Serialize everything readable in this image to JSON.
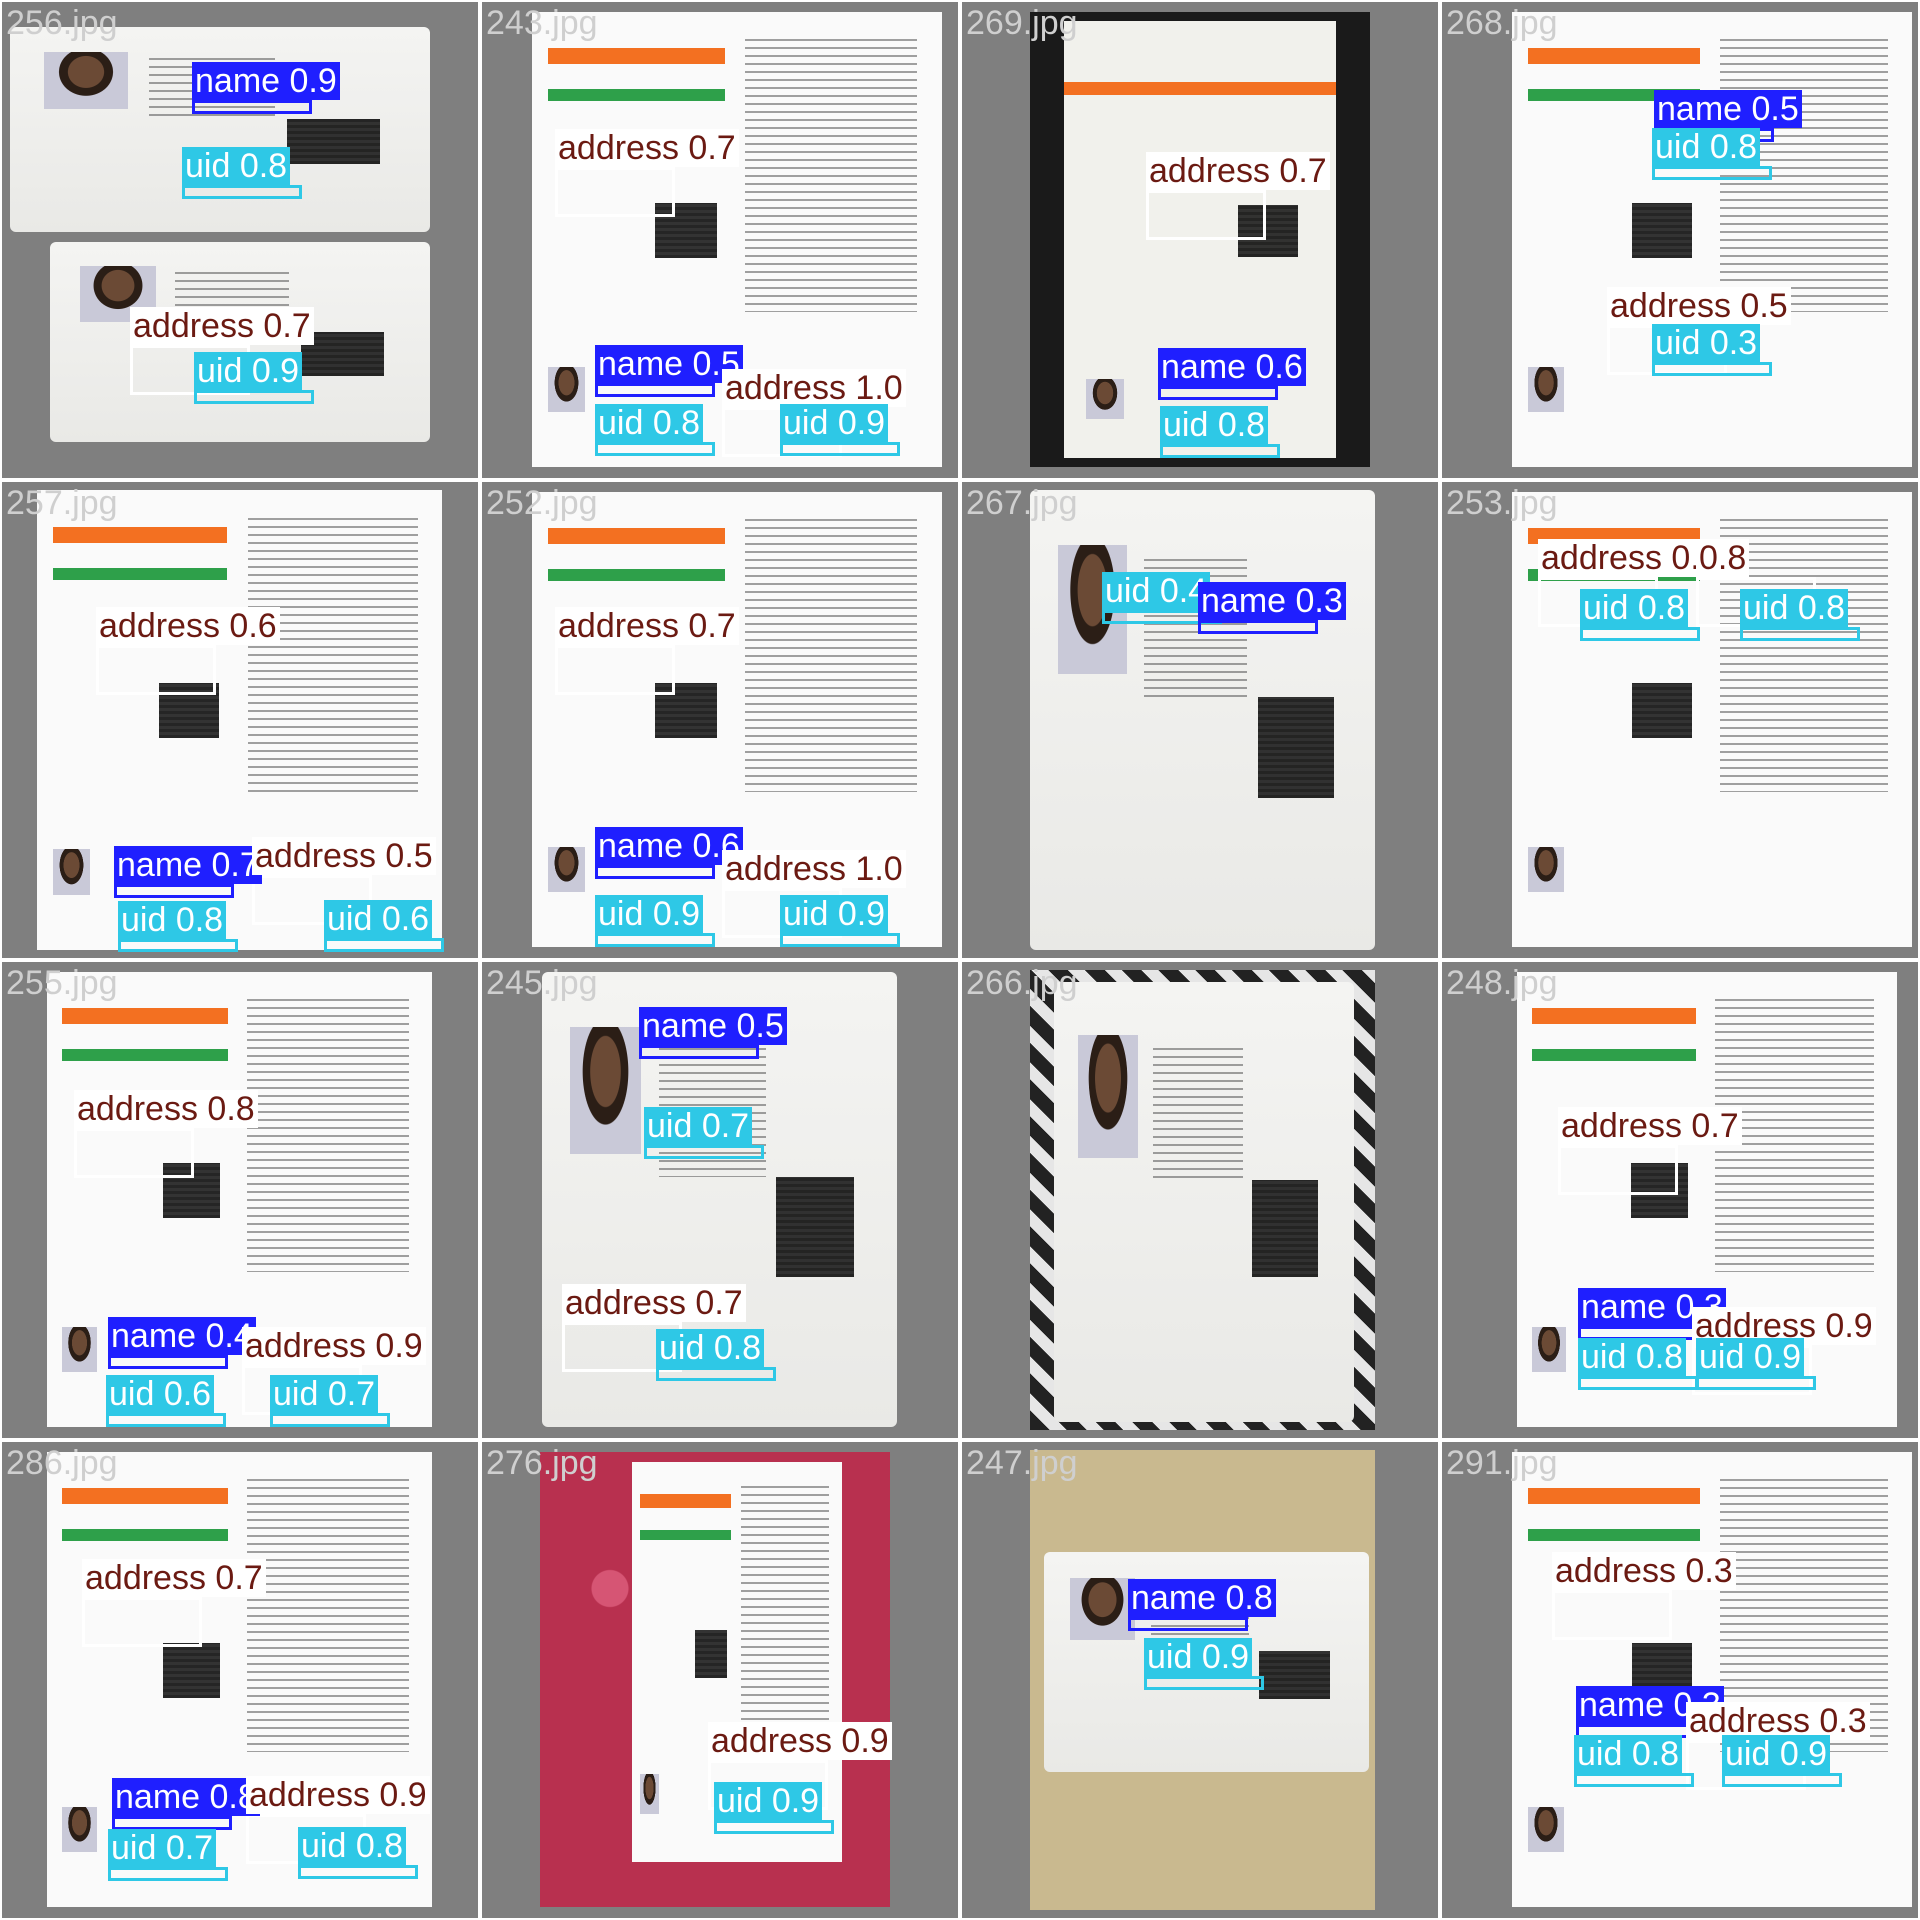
{
  "label_colors": {
    "name": "#1f1fff",
    "uid": "#2ec8e6",
    "address": "#ffffff"
  },
  "tiles": [
    {
      "title": "256.jpg",
      "detections": [
        {
          "cls": "name",
          "text": "name 0.9"
        },
        {
          "cls": "uid",
          "text": "uid 0.8"
        },
        {
          "cls": "address",
          "text": "address 0.7"
        },
        {
          "cls": "uid",
          "text": "uid 0.9"
        }
      ]
    },
    {
      "title": "243.jpg",
      "detections": [
        {
          "cls": "address",
          "text": "address 0.7"
        },
        {
          "cls": "name",
          "text": "name 0.5"
        },
        {
          "cls": "address",
          "text": "address 1.0"
        },
        {
          "cls": "uid",
          "text": "uid 0.8"
        },
        {
          "cls": "uid",
          "text": "uid 0.9"
        }
      ]
    },
    {
      "title": "269.jpg",
      "detections": [
        {
          "cls": "address",
          "text": "address 0.7"
        },
        {
          "cls": "name",
          "text": "name 0.6"
        },
        {
          "cls": "uid",
          "text": "uid 0.8"
        }
      ]
    },
    {
      "title": "268.jpg",
      "detections": [
        {
          "cls": "name",
          "text": "name 0.5"
        },
        {
          "cls": "uid",
          "text": "uid 0.8"
        },
        {
          "cls": "address",
          "text": "address 0.5"
        },
        {
          "cls": "uid",
          "text": "uid 0.3"
        }
      ]
    },
    {
      "title": "257.jpg",
      "detections": [
        {
          "cls": "address",
          "text": "address 0.6"
        },
        {
          "cls": "name",
          "text": "name 0.7"
        },
        {
          "cls": "address",
          "text": "address 0.5"
        },
        {
          "cls": "uid",
          "text": "uid 0.8"
        },
        {
          "cls": "uid",
          "text": "uid 0.6"
        }
      ]
    },
    {
      "title": "252.jpg",
      "detections": [
        {
          "cls": "address",
          "text": "address 0.7"
        },
        {
          "cls": "name",
          "text": "name 0.6"
        },
        {
          "cls": "address",
          "text": "address 1.0"
        },
        {
          "cls": "uid",
          "text": "uid 0.9"
        },
        {
          "cls": "uid",
          "text": "uid 0.9"
        }
      ]
    },
    {
      "title": "267.jpg",
      "detections": [
        {
          "cls": "uid",
          "text": "uid 0.4"
        },
        {
          "cls": "name",
          "text": "name 0.3"
        }
      ]
    },
    {
      "title": "253.jpg",
      "detections": [
        {
          "cls": "address",
          "text": "address 0.5"
        },
        {
          "cls": "address",
          "text": "0.8"
        },
        {
          "cls": "uid",
          "text": "uid 0.8"
        },
        {
          "cls": "uid",
          "text": "uid 0.8"
        }
      ]
    },
    {
      "title": "255.jpg",
      "detections": [
        {
          "cls": "address",
          "text": "address 0.8"
        },
        {
          "cls": "name",
          "text": "name 0.4"
        },
        {
          "cls": "address",
          "text": "address 0.9"
        },
        {
          "cls": "uid",
          "text": "uid 0.6"
        },
        {
          "cls": "uid",
          "text": "uid 0.7"
        }
      ]
    },
    {
      "title": "245.jpg",
      "detections": [
        {
          "cls": "name",
          "text": "name 0.5"
        },
        {
          "cls": "uid",
          "text": "uid 0.7"
        },
        {
          "cls": "address",
          "text": "address 0.7"
        },
        {
          "cls": "uid",
          "text": "uid 0.8"
        }
      ]
    },
    {
      "title": "266.jpg",
      "detections": []
    },
    {
      "title": "248.jpg",
      "detections": [
        {
          "cls": "address",
          "text": "address 0.7"
        },
        {
          "cls": "name",
          "text": "name 0.3"
        },
        {
          "cls": "address",
          "text": "address 0.9"
        },
        {
          "cls": "uid",
          "text": "uid 0.8"
        },
        {
          "cls": "uid",
          "text": "uid 0.9"
        }
      ]
    },
    {
      "title": "286.jpg",
      "detections": [
        {
          "cls": "address",
          "text": "address 0.7"
        },
        {
          "cls": "name",
          "text": "name 0.8"
        },
        {
          "cls": "address",
          "text": "address 0.9"
        },
        {
          "cls": "uid",
          "text": "uid 0.7"
        },
        {
          "cls": "uid",
          "text": "uid 0.8"
        }
      ]
    },
    {
      "title": "276.jpg",
      "detections": [
        {
          "cls": "address",
          "text": "address 0.9"
        },
        {
          "cls": "uid",
          "text": "uid 0.9"
        }
      ]
    },
    {
      "title": "247.jpg",
      "detections": [
        {
          "cls": "name",
          "text": "name 0.8"
        },
        {
          "cls": "uid",
          "text": "uid 0.9"
        }
      ]
    },
    {
      "title": "291.jpg",
      "detections": [
        {
          "cls": "address",
          "text": "address 0.3"
        },
        {
          "cls": "name",
          "text": "name 0.3"
        },
        {
          "cls": "address",
          "text": "address 0.3"
        },
        {
          "cls": "uid",
          "text": "uid 0.8"
        },
        {
          "cls": "uid",
          "text": "uid 0.9"
        }
      ]
    }
  ]
}
